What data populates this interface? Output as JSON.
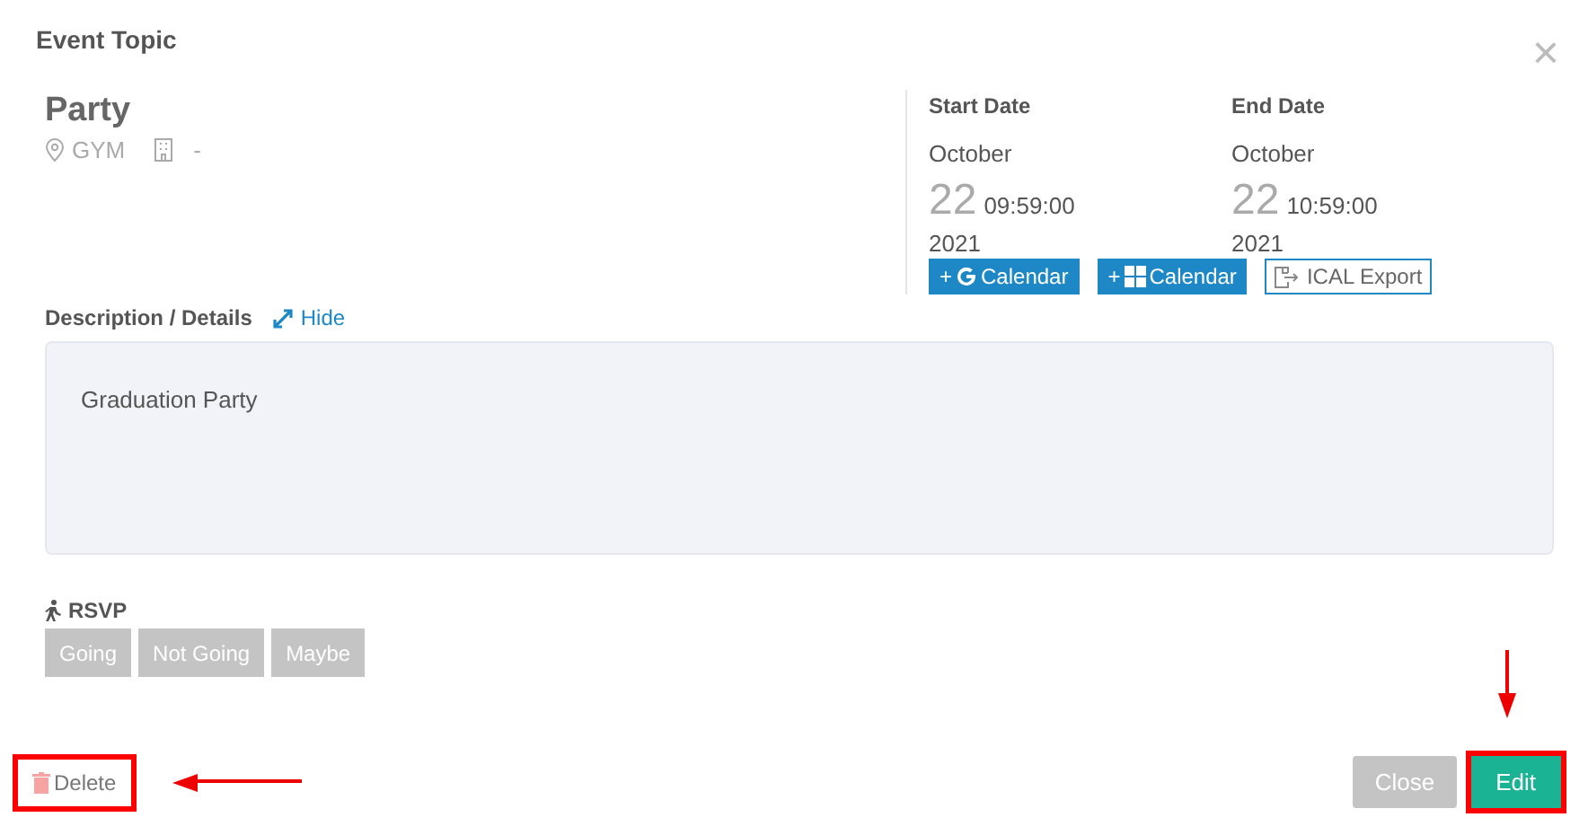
{
  "modal": {
    "title": "Event Topic",
    "close": "×"
  },
  "event": {
    "name": "Party",
    "location": "GYM",
    "room": "-"
  },
  "dates": [
    {
      "label": "Start Date",
      "month": "October",
      "day": "22",
      "time": "09:59:00",
      "year": "2021"
    },
    {
      "label": "End Date",
      "month": "October",
      "day": "22",
      "time": "10:59:00",
      "year": "2021"
    }
  ],
  "calendar_buttons": [
    {
      "kind": "google",
      "plus": "+",
      "label": "Calendar"
    },
    {
      "kind": "windows",
      "plus": "+",
      "label": "Calendar"
    },
    {
      "kind": "ical",
      "label": "ICAL Export"
    }
  ],
  "description": {
    "label": "Description / Details",
    "toggle": "Hide",
    "text": "Graduation Party"
  },
  "rsvp": {
    "label": "RSVP",
    "options": [
      {
        "label": "Going",
        "selected": false
      },
      {
        "label": "Not Going",
        "selected": false
      },
      {
        "label": "Maybe",
        "selected": false
      }
    ]
  },
  "footer": {
    "delete": {
      "label": "Delete",
      "highlighted": true
    },
    "close": {
      "label": "Close",
      "highlighted": false
    },
    "edit": {
      "label": "Edit",
      "highlighted": true
    }
  }
}
